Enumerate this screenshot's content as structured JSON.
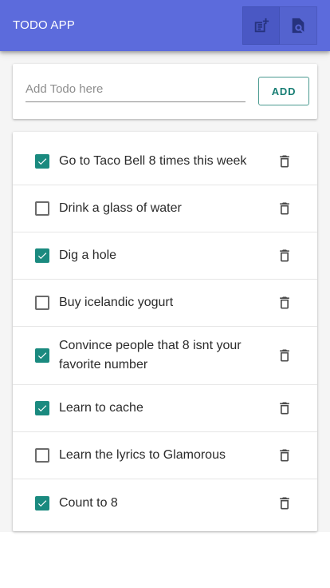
{
  "header": {
    "title": "TODO APP",
    "actions": [
      {
        "icon": "note-add-icon"
      },
      {
        "icon": "search-document-icon"
      }
    ]
  },
  "add_form": {
    "placeholder": "Add Todo here",
    "value": "",
    "add_label": "ADD"
  },
  "todos": [
    {
      "text": "Go to Taco Bell 8 times this week",
      "done": true
    },
    {
      "text": "Drink a glass of water",
      "done": false
    },
    {
      "text": "Dig a hole",
      "done": true
    },
    {
      "text": "Buy icelandic yogurt",
      "done": false
    },
    {
      "text": "Convince people that 8 isnt your favorite number",
      "done": true
    },
    {
      "text": "Learn to cache",
      "done": true
    },
    {
      "text": "Learn the lyrics to Glamorous",
      "done": false
    },
    {
      "text": "Count to 8",
      "done": true
    }
  ],
  "colors": {
    "appbar": "#5c6bdc",
    "accent": "#1a8a7f"
  }
}
